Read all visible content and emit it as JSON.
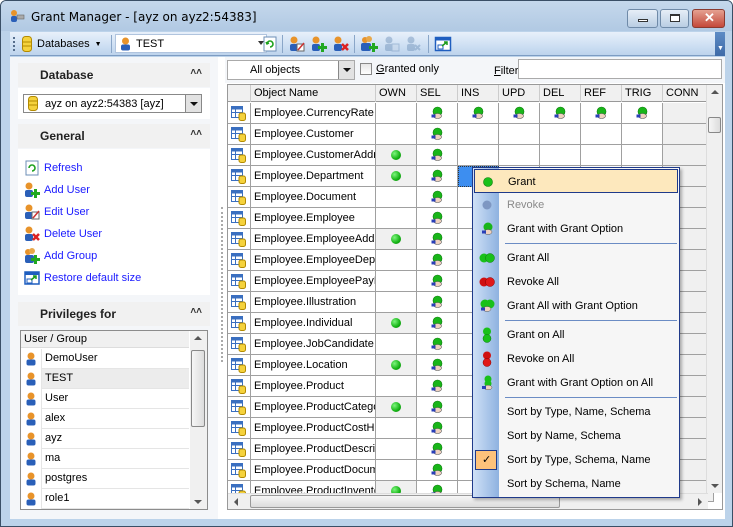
{
  "window": {
    "title": "Grant Manager - [ayz on ayz2:54383]"
  },
  "toolbar": {
    "databases_label": "Databases",
    "user_combo_value": "TEST",
    "icons": [
      "refresh-icon",
      "edit-user-icon",
      "add-user-icon",
      "delete-user-icon",
      "add-group-icon",
      "grant-user-icon-disabled",
      "revoke-user-icon-disabled",
      "restore-size-icon"
    ]
  },
  "sidebar": {
    "database": {
      "title": "Database",
      "combo_value": "ayz on ayz2:54383 [ayz]"
    },
    "general": {
      "title": "General",
      "links": [
        {
          "label": "Refresh",
          "icon": "refresh-icon"
        },
        {
          "label": "Add User",
          "icon": "add-user-icon"
        },
        {
          "label": "Edit User",
          "icon": "edit-user-icon"
        },
        {
          "label": "Delete User",
          "icon": "delete-user-icon"
        },
        {
          "label": "Add Group",
          "icon": "add-group-icon"
        },
        {
          "label": "Restore default size",
          "icon": "restore-size-icon"
        }
      ]
    },
    "privileges": {
      "title": "Privileges for",
      "column_header": "User / Group",
      "users": [
        "DemoUser",
        "TEST",
        "User",
        "alex",
        "ayz",
        "ma",
        "postgres",
        "role1"
      ],
      "selected": "TEST"
    }
  },
  "filterbar": {
    "object_type_value": "All objects",
    "granted_only_label": "Granted only",
    "granted_only_checked": false,
    "filter_label": "Filter",
    "filter_value": ""
  },
  "grid": {
    "columns": [
      "Object Name",
      "OWN",
      "SEL",
      "INS",
      "UPD",
      "DEL",
      "REF",
      "TRIG",
      "CONN"
    ],
    "rows": [
      {
        "name": "Employee.CurrencyRate",
        "OWN": "",
        "SEL": "grant-option",
        "INS": "grant-option",
        "UPD": "grant-option",
        "DEL": "grant-option",
        "REF": "grant-option",
        "TRIG": "grant-option"
      },
      {
        "name": "Employee.Customer",
        "OWN": "",
        "SEL": "grant-option"
      },
      {
        "name": "Employee.CustomerAddr",
        "OWN": "granted",
        "SEL": "grant-option"
      },
      {
        "name": "Employee.Department",
        "OWN": "granted",
        "SEL": "grant-option"
      },
      {
        "name": "Employee.Document",
        "OWN": "",
        "SEL": "grant-option"
      },
      {
        "name": "Employee.Employee",
        "OWN": "",
        "SEL": "grant-option"
      },
      {
        "name": "Employee.EmployeeAddr",
        "OWN": "granted",
        "SEL": "grant-option"
      },
      {
        "name": "Employee.EmployeeDepa",
        "OWN": "",
        "SEL": "grant-option"
      },
      {
        "name": "Employee.EmployeePayH",
        "OWN": "",
        "SEL": "grant-option"
      },
      {
        "name": "Employee.Illustration",
        "OWN": "",
        "SEL": "grant-option"
      },
      {
        "name": "Employee.Individual",
        "OWN": "granted",
        "SEL": "grant-option"
      },
      {
        "name": "Employee.JobCandidate",
        "OWN": "",
        "SEL": "grant-option"
      },
      {
        "name": "Employee.Location",
        "OWN": "granted",
        "SEL": "grant-option"
      },
      {
        "name": "Employee.Product",
        "OWN": "",
        "SEL": "grant-option"
      },
      {
        "name": "Employee.ProductCatego",
        "OWN": "granted",
        "SEL": "grant-option"
      },
      {
        "name": "Employee.ProductCostHi",
        "OWN": "",
        "SEL": "grant-option"
      },
      {
        "name": "Employee.ProductDescri",
        "OWN": "",
        "SEL": "grant-option"
      },
      {
        "name": "Employee.ProductDocum",
        "OWN": "",
        "SEL": "grant-option"
      },
      {
        "name": "Employee.ProductInvento",
        "OWN": "granted",
        "SEL": "grant-option"
      }
    ],
    "selected_cell": {
      "row": 3,
      "column": "INS"
    }
  },
  "context_menu": {
    "items": [
      {
        "label": "Grant",
        "icon": "green-dot-icon",
        "highlighted": true
      },
      {
        "label": "Revoke",
        "icon": "gray-dot-icon",
        "disabled": true
      },
      {
        "label": "Grant with Grant Option",
        "icon": "grant-option-icon"
      },
      {
        "separator": true
      },
      {
        "label": "Grant All",
        "icon": "two-green-dots-icon"
      },
      {
        "label": "Revoke All",
        "icon": "two-red-dots-icon"
      },
      {
        "label": "Grant All with Grant Option",
        "icon": "grant-all-option-icon"
      },
      {
        "separator": true
      },
      {
        "label": "Grant on All",
        "icon": "stacked-green-dots-icon"
      },
      {
        "label": "Revoke on All",
        "icon": "stacked-red-dots-icon"
      },
      {
        "label": "Grant with Grant Option on All",
        "icon": "grant-option-on-all-icon"
      },
      {
        "separator": true
      },
      {
        "label": "Sort by Type, Name, Schema"
      },
      {
        "label": "Sort by Name, Schema"
      },
      {
        "label": "Sort by Type, Schema, Name",
        "checked": true
      },
      {
        "label": "Sort by Schema, Name"
      }
    ]
  },
  "colors": {
    "accent_menu_border": "#1f3a8a",
    "highlight": "#fde8bd",
    "link": "#1a1aff",
    "granted_green": "#13b213",
    "revoke_red": "#d01010",
    "selected_cell": "#3d8ef0"
  }
}
